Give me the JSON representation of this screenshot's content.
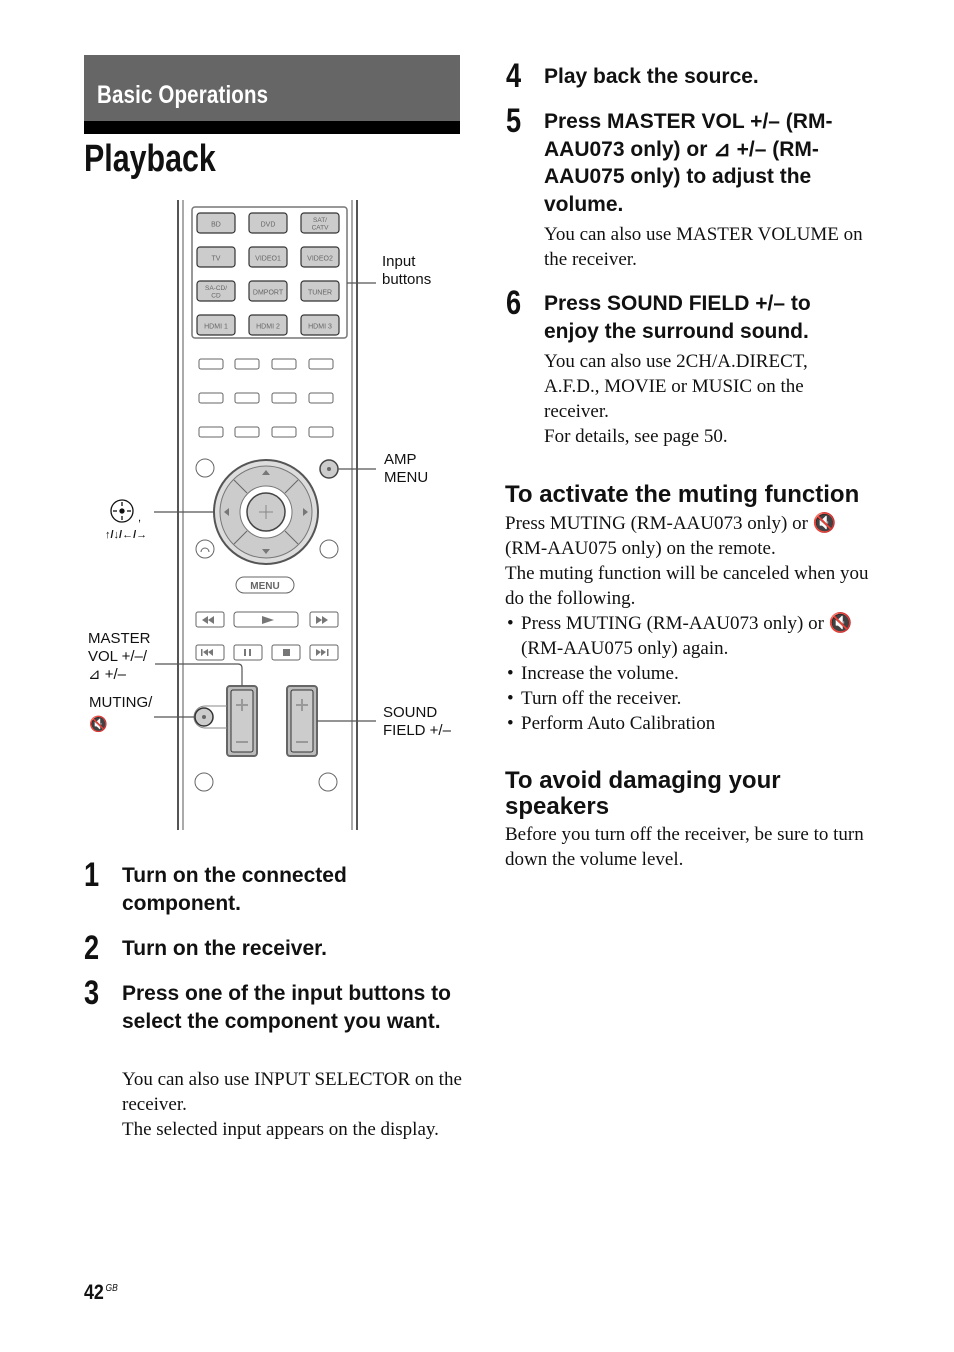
{
  "header": {
    "section": "Basic Operations",
    "title": "Playback"
  },
  "remote": {
    "input_buttons": [
      [
        "BD",
        "DVD",
        "SAT/\nCATV"
      ],
      [
        "TV",
        "VIDEO1",
        "VIDEO2"
      ],
      [
        "SA-CD/\nCD",
        "DMPORT",
        "TUNER"
      ],
      [
        "HDMI 1",
        "HDMI 2",
        "HDMI 3"
      ]
    ],
    "menu_label": "MENU",
    "callouts": {
      "input_buttons": [
        "Input",
        "buttons"
      ],
      "amp_menu": [
        "AMP",
        "MENU"
      ],
      "cursor": "↑/↓/←/→",
      "master_vol": [
        "MASTER",
        "VOL +/–/",
        "⊿ +/–"
      ],
      "muting": [
        "MUTING/",
        "🔇"
      ],
      "sound_field": [
        "SOUND",
        "FIELD +/–"
      ]
    }
  },
  "steps_left": [
    {
      "num": "1",
      "title": "Turn on the connected component.",
      "body": []
    },
    {
      "num": "2",
      "title": "Turn on the receiver.",
      "body": []
    },
    {
      "num": "3",
      "title": "Press one of the input buttons to select the component you want.",
      "body": [
        "You can also use INPUT SELECTOR on the receiver.",
        "The selected input appears on the display."
      ]
    }
  ],
  "steps_right": [
    {
      "num": "4",
      "title": "Play back the source.",
      "body": []
    },
    {
      "num": "5",
      "title": "Press MASTER VOL +/– (RM-AAU073 only) or ⊿ +/– (RM-AAU075 only) to adjust the volume.",
      "body": [
        "You can also use MASTER VOLUME on the receiver."
      ]
    },
    {
      "num": "6",
      "title": "Press SOUND FIELD +/– to enjoy the surround sound.",
      "body": [
        "You can also use 2CH/A.DIRECT, A.F.D., MOVIE or MUSIC on the receiver.",
        "For details, see page 50."
      ]
    }
  ],
  "muting_section": {
    "heading": "To activate the muting function",
    "intro": "Press MUTING (RM-AAU073 only) or 🔇 (RM-AAU075 only) on the remote.",
    "cancel_text": "The muting function will be canceled when you do the following.",
    "bullets": [
      "Press MUTING (RM-AAU073 only) or 🔇 (RM-AAU075 only) again.",
      "Increase the volume.",
      "Turn off the receiver.",
      "Perform Auto Calibration"
    ]
  },
  "speakers_section": {
    "heading": "To avoid damaging your speakers",
    "body": "Before you turn off the receiver, be sure to turn down the volume level."
  },
  "footer": {
    "page": "42",
    "suffix": "GB"
  }
}
